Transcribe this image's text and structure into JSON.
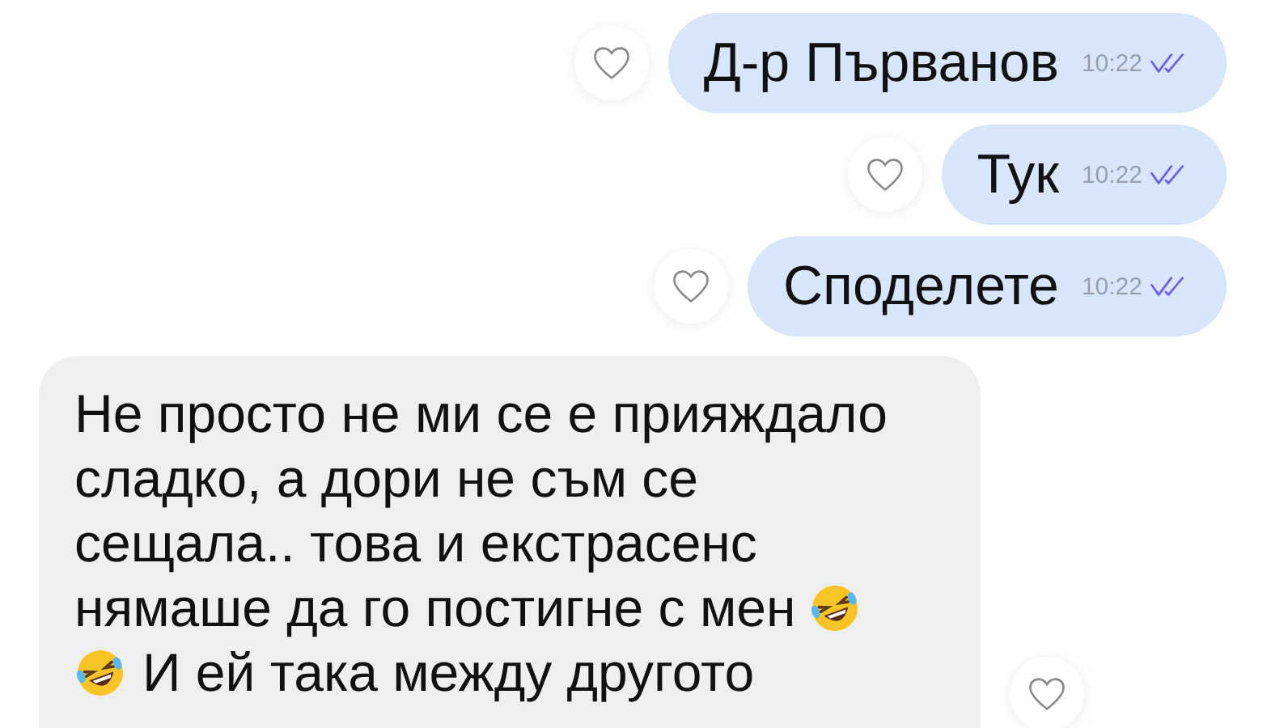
{
  "messages": [
    {
      "kind": "sent",
      "text": "Д-р Първанов",
      "time": "10:22",
      "liked": false
    },
    {
      "kind": "sent",
      "text": "Тук",
      "time": "10:22",
      "liked": false
    },
    {
      "kind": "sent",
      "text": "Споделете",
      "time": "10:22",
      "liked": false
    },
    {
      "kind": "received",
      "liked": false,
      "lines": [
        [
          {
            "kind": "text",
            "text": "Не просто не ми се е прияждало"
          }
        ],
        [
          {
            "kind": "text",
            "text": "сладко, а дори не съм се"
          }
        ],
        [
          {
            "kind": "text",
            "text": "сещала.. това и екстрасенс"
          }
        ],
        [
          {
            "kind": "text",
            "text": "нямаше да го постигне с мен"
          },
          {
            "kind": "emoji"
          }
        ],
        [
          {
            "kind": "emoji"
          },
          {
            "kind": "text",
            "text": "И ей така между другото"
          }
        ]
      ]
    }
  ]
}
